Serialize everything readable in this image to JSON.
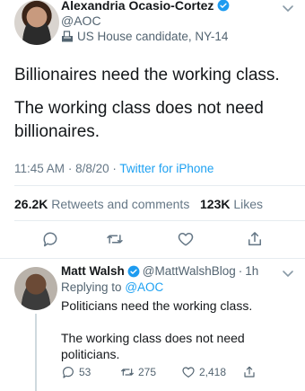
{
  "main_tweet": {
    "display_name": "Alexandria Ocasio-Cortez",
    "handle": "@AOC",
    "candidate_label": "US House candidate, NY-14",
    "text_line1": "Billionaires need the working class.",
    "text_line2": "The working class does not need billionaires.",
    "time": "11:45 AM",
    "date": "8/8/20",
    "source": "Twitter for iPhone",
    "retweets_count": "26.2K",
    "retweets_label": "Retweets and comments",
    "likes_count": "123K",
    "likes_label": "Likes"
  },
  "reply_tweet": {
    "display_name": "Matt Walsh",
    "handle": "@MattWalshBlog",
    "age": "1h",
    "replying_prefix": "Replying to",
    "replying_handle": "@AOC",
    "text_line1": "Politicians need the working class.",
    "text_line2": "The working class does not need politicians.",
    "reply_count": "53",
    "retweet_count": "275",
    "like_count": "2,418"
  },
  "colors": {
    "accent": "#1da1f2",
    "verified": "#1d9bf0",
    "muted": "#657786"
  },
  "icons": [
    "verified-badge-icon",
    "ballot-box-icon",
    "chevron-down-icon",
    "reply-icon",
    "retweet-icon",
    "like-icon",
    "share-icon"
  ]
}
